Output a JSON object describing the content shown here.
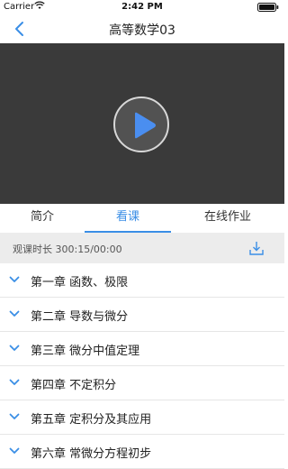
{
  "status": {
    "carrier": "Carrier",
    "time": "2:42 PM"
  },
  "nav": {
    "title": "高等数学03"
  },
  "tabs": [
    {
      "label": "简介",
      "active": false
    },
    {
      "label": "看课",
      "active": true
    },
    {
      "label": "在线作业",
      "active": false
    }
  ],
  "watch": {
    "label": "观课时长 300:15/00:00"
  },
  "chapters": [
    {
      "title": "第一章 函数、极限"
    },
    {
      "title": "第二章 导数与微分"
    },
    {
      "title": "第三章 微分中值定理"
    },
    {
      "title": "第四章 不定积分"
    },
    {
      "title": "第五章 定积分及其应用"
    },
    {
      "title": "第六章 常微分方程初步"
    }
  ],
  "colors": {
    "accent": "#3a8ee6",
    "video_bg": "#3a3a3a",
    "play": "#4a8ef0"
  },
  "icons": {
    "back": "chevron-left-icon",
    "play": "play-icon",
    "download": "download-icon",
    "chapter": "chevron-down-icon"
  }
}
